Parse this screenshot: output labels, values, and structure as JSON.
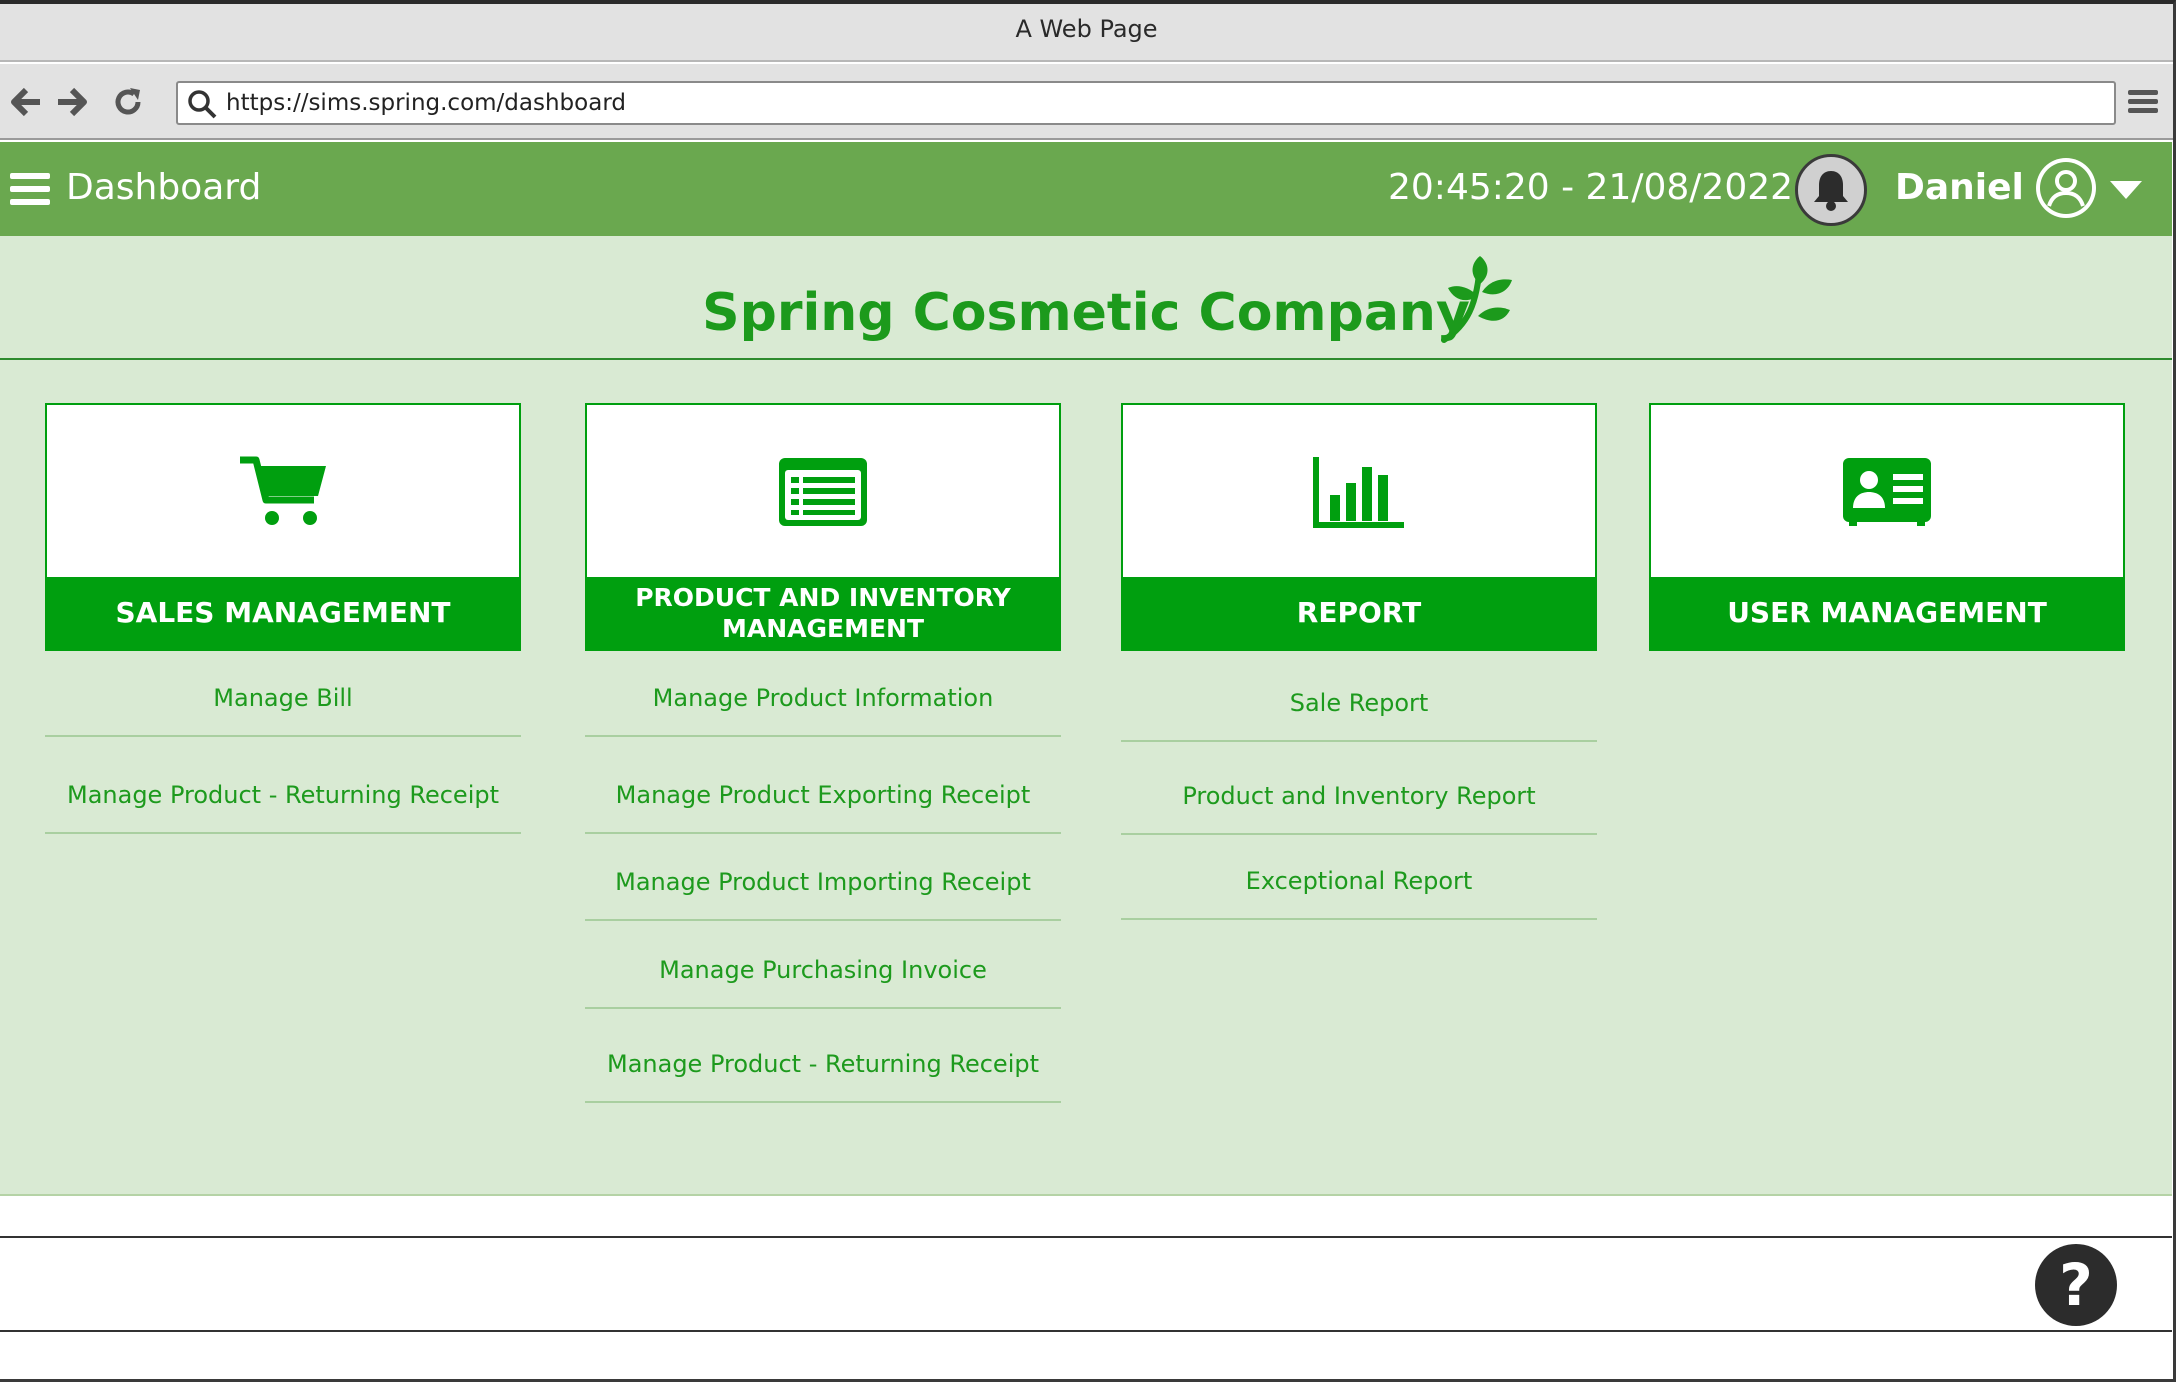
{
  "browser": {
    "title": "A Web Page",
    "url": "https://sims.spring.com/dashboard"
  },
  "header": {
    "title": "Dashboard",
    "datetime": "20:45:20 - 21/08/2022",
    "username": "Daniel"
  },
  "brand": {
    "company_name": "Spring Cosmetic Company"
  },
  "modules": [
    {
      "title": "SALES MANAGEMENT",
      "icon": "shopping-cart-icon",
      "links": [
        "Manage Bill",
        "Manage Product - Returning Receipt"
      ]
    },
    {
      "title": "PRODUCT AND INVENTORY MANAGEMENT",
      "icon": "list-icon",
      "links": [
        "Manage Product Information",
        "Manage Product Exporting Receipt",
        "Manage Product Importing Receipt",
        "Manage Purchasing Invoice",
        "Manage Product - Returning Receipt"
      ]
    },
    {
      "title": "REPORT",
      "icon": "bar-chart-icon",
      "links": [
        "Sale Report",
        "Product and Inventory Report",
        "Exceptional Report"
      ]
    },
    {
      "title": "USER MANAGEMENT",
      "icon": "id-card-icon",
      "links": []
    }
  ],
  "footer": {
    "help_symbol": "?"
  },
  "colors": {
    "header_green": "#6aa84f",
    "content_bg": "#d9ead3",
    "accent_green": "#009f0f",
    "link_green": "#1d9a1d"
  }
}
